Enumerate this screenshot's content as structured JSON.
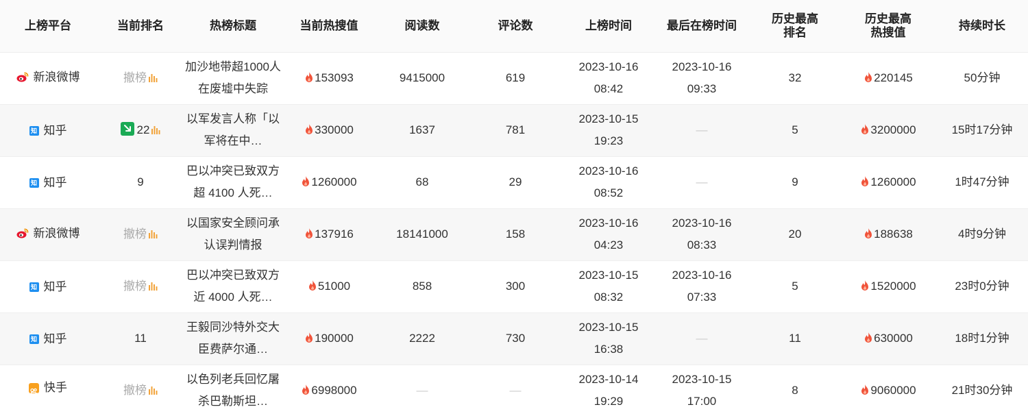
{
  "header": {
    "platform": "上榜平台",
    "current_rank": "当前排名",
    "title": "热榜标题",
    "current_heat": "当前热搜值",
    "reads": "阅读数",
    "comments": "评论数",
    "first_on": "上榜时间",
    "last_on": "最后在榜时间",
    "peak_rank": "历史最高\n排名",
    "peak_heat": "历史最高\n热搜值",
    "duration": "持续时长"
  },
  "colors": {
    "flame": "#f0533a",
    "rank_down": "#1aaa55",
    "bars": "#f2a33a",
    "zhihu": "#1e8ff0",
    "weibo": "#e6162d",
    "kuaishou": "#f8a01e"
  },
  "rows": [
    {
      "platform": "新浪微博",
      "platform_icon": "weibo-icon",
      "rank_text": "撤榜",
      "rank_withdrawn": true,
      "title": "加沙地带超1000人在废墟中失踪",
      "heat": "153093",
      "reads": "9415000",
      "comments": "619",
      "first_date": "2023-10-16",
      "first_time": "08:42",
      "last_date": "2023-10-16",
      "last_time": "09:33",
      "peak_rank": "32",
      "peak_heat": "220145",
      "duration": "50分钟"
    },
    {
      "platform": "知乎",
      "platform_icon": "zhihu-icon",
      "rank_text": "22",
      "rank_down": true,
      "title": "以军发言人称「以军将在中…",
      "heat": "330000",
      "reads": "1637",
      "comments": "781",
      "first_date": "2023-10-15",
      "first_time": "19:23",
      "last_date": "—",
      "last_time": "",
      "peak_rank": "5",
      "peak_heat": "3200000",
      "duration": "15时17分钟"
    },
    {
      "platform": "知乎",
      "platform_icon": "zhihu-icon",
      "rank_text": "9",
      "title": "巴以冲突已致双方超 4100 人死…",
      "heat": "1260000",
      "reads": "68",
      "comments": "29",
      "first_date": "2023-10-16",
      "first_time": "08:52",
      "last_date": "—",
      "last_time": "",
      "peak_rank": "9",
      "peak_heat": "1260000",
      "duration": "1时47分钟"
    },
    {
      "platform": "新浪微博",
      "platform_icon": "weibo-icon",
      "rank_text": "撤榜",
      "rank_withdrawn": true,
      "title": "以国家安全顾问承认误判情报",
      "heat": "137916",
      "reads": "18141000",
      "comments": "158",
      "first_date": "2023-10-16",
      "first_time": "04:23",
      "last_date": "2023-10-16",
      "last_time": "08:33",
      "peak_rank": "20",
      "peak_heat": "188638",
      "duration": "4时9分钟"
    },
    {
      "platform": "知乎",
      "platform_icon": "zhihu-icon",
      "rank_text": "撤榜",
      "rank_withdrawn": true,
      "title": "巴以冲突已致双方近 4000 人死…",
      "heat": "51000",
      "reads": "858",
      "comments": "300",
      "first_date": "2023-10-15",
      "first_time": "08:32",
      "last_date": "2023-10-16",
      "last_time": "07:33",
      "peak_rank": "5",
      "peak_heat": "1520000",
      "duration": "23时0分钟"
    },
    {
      "platform": "知乎",
      "platform_icon": "zhihu-icon",
      "rank_text": "11",
      "title": "王毅同沙特外交大臣费萨尔通…",
      "heat": "190000",
      "reads": "2222",
      "comments": "730",
      "first_date": "2023-10-15",
      "first_time": "16:38",
      "last_date": "—",
      "last_time": "",
      "peak_rank": "11",
      "peak_heat": "630000",
      "duration": "18时1分钟"
    },
    {
      "platform": "快手",
      "platform_icon": "kuaishou-icon",
      "rank_text": "撤榜",
      "rank_withdrawn": true,
      "title": "以色列老兵回忆屠杀巴勒斯坦…",
      "heat": "6998000",
      "reads": "—",
      "comments": "—",
      "first_date": "2023-10-14",
      "first_time": "19:29",
      "last_date": "2023-10-15",
      "last_time": "17:00",
      "peak_rank": "8",
      "peak_heat": "9060000",
      "duration": "21时30分钟"
    }
  ]
}
